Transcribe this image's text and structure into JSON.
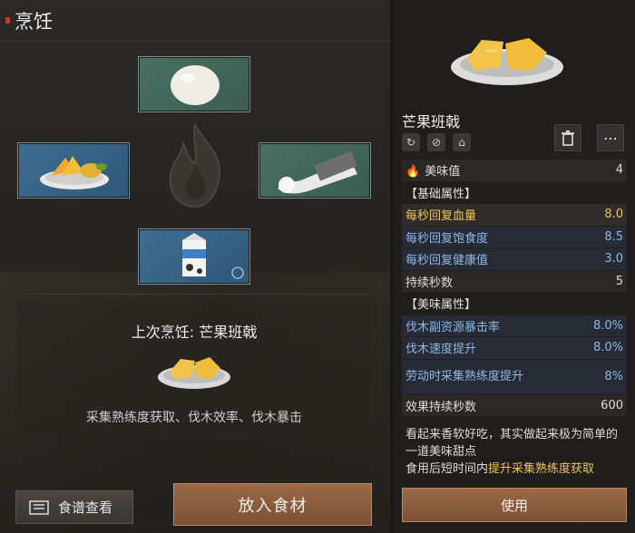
{
  "panel": {
    "title": "烹饪"
  },
  "slots": {
    "top": {
      "item": "egg"
    },
    "left": {
      "item": "mango-dish"
    },
    "right": {
      "item": "flour-bag"
    },
    "bottom": {
      "item": "milk-carton"
    }
  },
  "last_cook": {
    "title": "上次烹饪: 芒果班戟",
    "effects": "采集熟练度获取、伐木效率、伐木暴击"
  },
  "buttons": {
    "recipe": "食谱查看",
    "add_ingredient": "放入食材",
    "use": "使用"
  },
  "detail": {
    "name": "芒果班戟",
    "icons": [
      "swirl-icon",
      "clock-icon",
      "house-icon"
    ],
    "taste": {
      "label": "美味值",
      "value": "4"
    },
    "base_section": "【基础属性】",
    "base_stats": [
      {
        "label": "每秒回复血量",
        "value": "8.0"
      },
      {
        "label": "每秒回复饱食度",
        "value": "8.5"
      },
      {
        "label": "每秒回复健康值",
        "value": "3.0"
      },
      {
        "label": "持续秒数",
        "value": "5"
      }
    ],
    "taste_section": "【美味属性】",
    "taste_stats": [
      {
        "label": "伐木副资源暴击率",
        "value": "8.0%"
      },
      {
        "label": "伐木速度提升",
        "value": "8.0%"
      },
      {
        "label": "劳动时采集熟练度提升",
        "value": "8%"
      },
      {
        "label": "效果持续秒数",
        "value": "600"
      }
    ],
    "description": "看起来香软好吃，其实做起来极为简单的一道美味甜点",
    "effect_prefix": "食用后短时间内",
    "effect_accent": "提升采集熟练度获取"
  }
}
